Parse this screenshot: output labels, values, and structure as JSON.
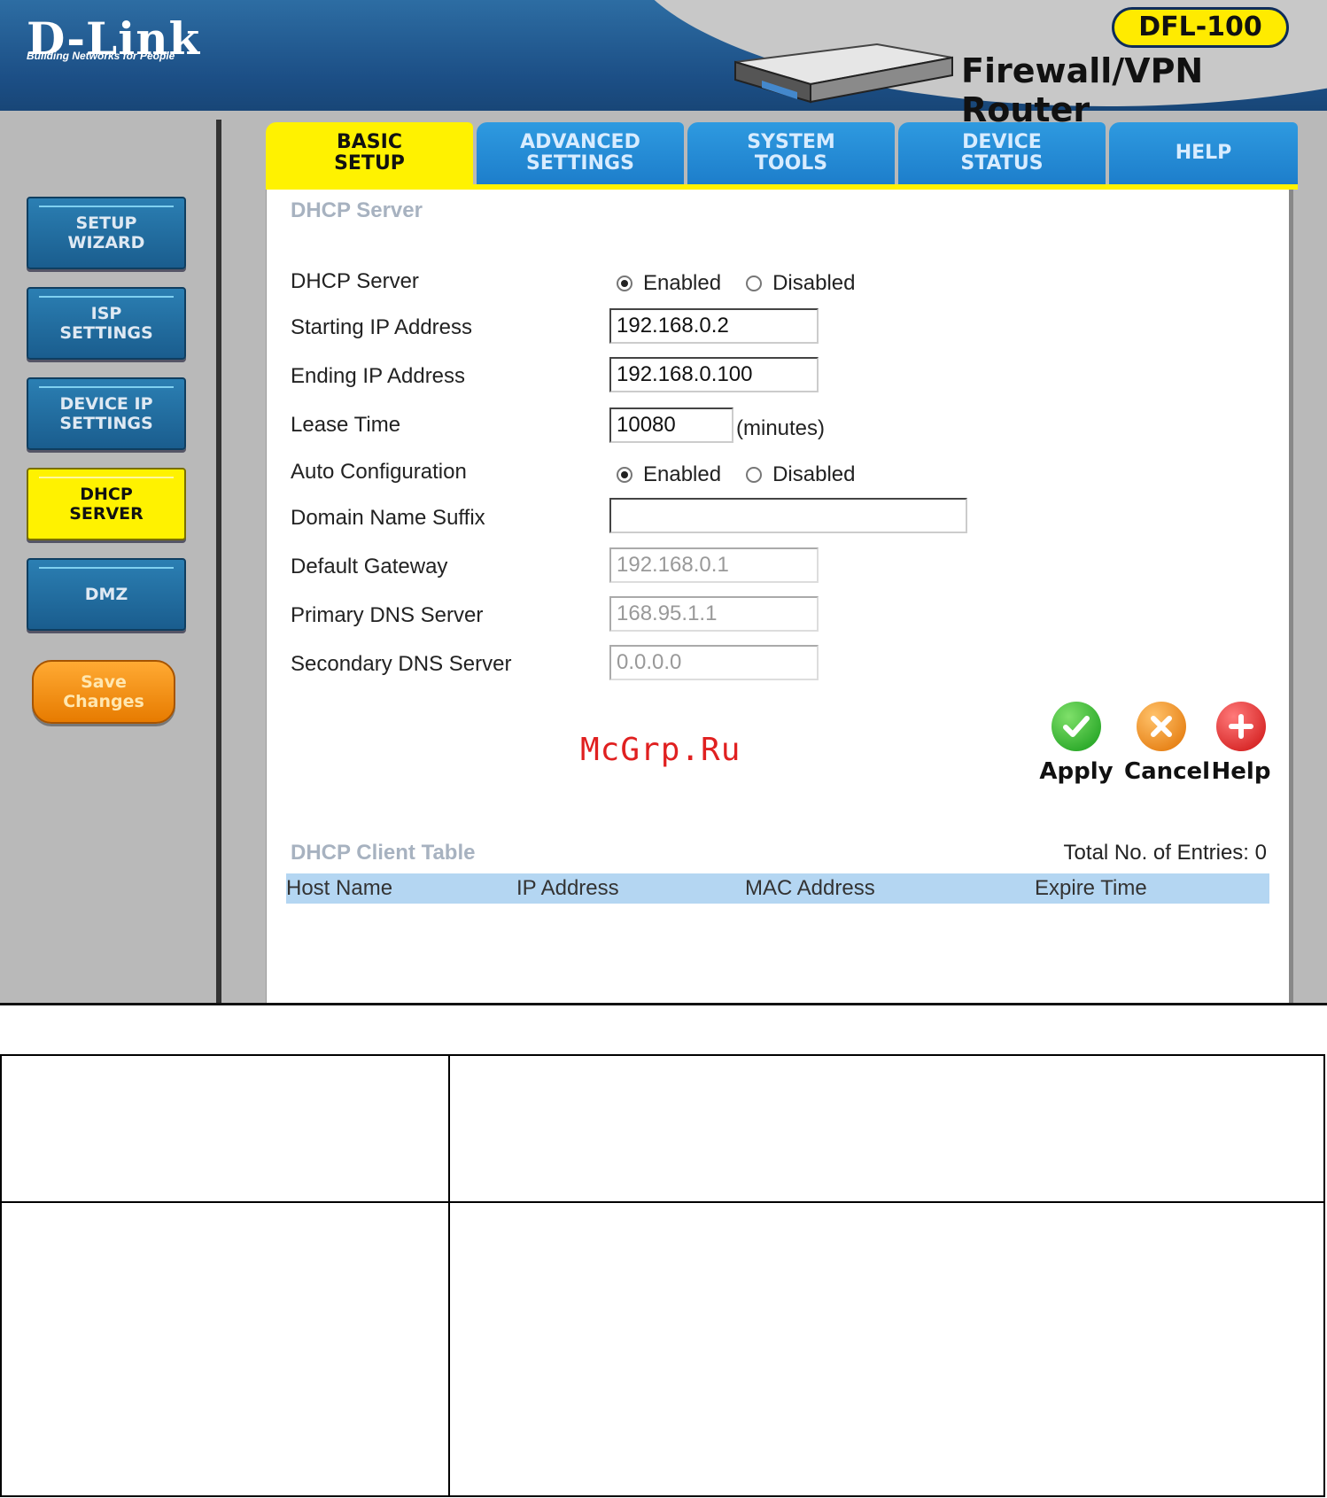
{
  "header": {
    "brand": "D-Link",
    "tagline": "Building Networks for People",
    "model": "DFL-100",
    "product": "Firewall/VPN Router"
  },
  "tabs": [
    {
      "label": "BASIC\nSETUP",
      "active": true
    },
    {
      "label": "ADVANCED\nSETTINGS",
      "active": false
    },
    {
      "label": "SYSTEM\nTOOLS",
      "active": false
    },
    {
      "label": "DEVICE\nSTATUS",
      "active": false
    },
    {
      "label": "HELP",
      "active": false
    }
  ],
  "sidebar": {
    "items": [
      {
        "label": "SETUP\nWIZARD",
        "active": false
      },
      {
        "label": "ISP\nSETTINGS",
        "active": false
      },
      {
        "label": "DEVICE IP\nSETTINGS",
        "active": false
      },
      {
        "label": "DHCP\nSERVER",
        "active": true
      },
      {
        "label": "DMZ",
        "active": false
      }
    ],
    "save": "Save\nChanges"
  },
  "form": {
    "section_title": "DHCP Server",
    "dhcp_server_label": "DHCP Server",
    "dhcp_enabled": "Enabled",
    "dhcp_disabled": "Disabled",
    "start_ip_label": "Starting IP Address",
    "start_ip": "192.168.0.2",
    "end_ip_label": "Ending IP Address",
    "end_ip": "192.168.0.100",
    "lease_label": "Lease Time",
    "lease": "10080",
    "lease_unit": "(minutes)",
    "auto_label": "Auto Configuration",
    "auto_enabled": "Enabled",
    "auto_disabled": "Disabled",
    "domain_label": "Domain Name Suffix",
    "domain": "",
    "gateway_label": "Default Gateway",
    "gateway": "192.168.0.1",
    "dns1_label": "Primary DNS Server",
    "dns1": "168.95.1.1",
    "dns2_label": "Secondary DNS Server",
    "dns2": "0.0.0.0"
  },
  "actions": {
    "apply": "Apply",
    "cancel": "Cancel",
    "help": "Help"
  },
  "watermark": "McGrp.Ru",
  "client_table": {
    "title": "DHCP Client Table",
    "total": "Total No. of Entries: 0",
    "columns": [
      "Host Name",
      "IP Address",
      "MAC Address",
      "Expire Time"
    ]
  },
  "colors": {
    "accent_yellow": "#fff200",
    "tab_blue": "#1d7ecb",
    "header_blue": "#1c4f86",
    "save_orange": "#e77b00"
  }
}
